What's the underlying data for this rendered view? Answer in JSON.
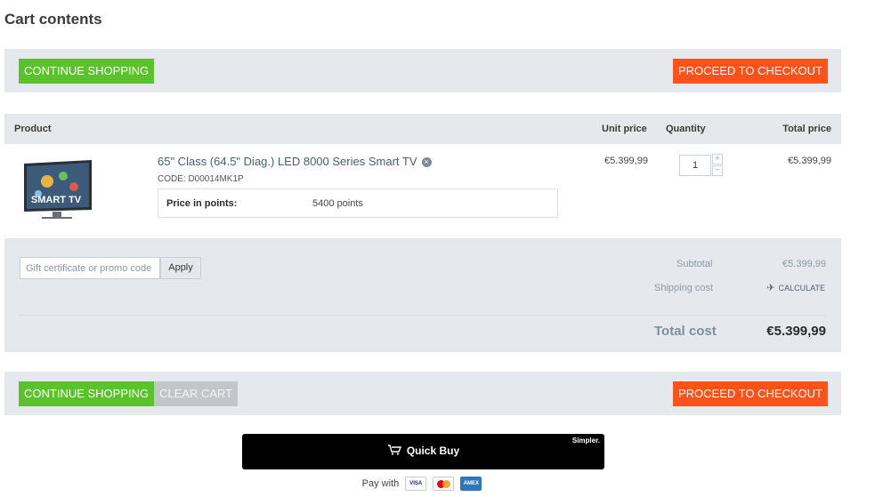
{
  "page": {
    "title": "Cart contents"
  },
  "buttons": {
    "continue_shopping": "CONTINUE SHOPPING",
    "proceed_to_checkout": "PROCEED TO CHECKOUT",
    "clear_cart": "CLEAR CART"
  },
  "table": {
    "headers": {
      "product": "Product",
      "unit_price": "Unit price",
      "quantity": "Quantity",
      "total_price": "Total price"
    },
    "items": [
      {
        "name": "65\" Class (64.5\" Diag.) LED 8000 Series Smart TV",
        "code": "CODE: D00014MK1P",
        "points_label": "Price in points:",
        "points_value": "5400 points",
        "unit_price": "€5.399,99",
        "quantity": "1",
        "total_price": "€5.399,99",
        "thumb_text": "SMART TV"
      }
    ]
  },
  "summary": {
    "promo_placeholder": "Gift certificate or promo code",
    "apply_label": "Apply",
    "subtotal_label": "Subtotal",
    "subtotal_value": "€5.399,99",
    "shipping_label": "Shipping cost",
    "shipping_action": "CALCULATE",
    "total_label": "Total cost",
    "total_value": "€5.399,99"
  },
  "quick_buy": {
    "label": "Quick Buy",
    "brand": "Simpler."
  },
  "payment": {
    "label": "Pay with",
    "cards": [
      "VISA",
      "mastercard",
      "AMEX"
    ]
  },
  "colors": {
    "green": "#5ac22a",
    "orange": "#ff5219",
    "bar_gray": "#e5e8ec"
  },
  "icons": {
    "remove": "close-circle-icon",
    "shipping": "plane-icon",
    "quick_buy": "cart-lightning-icon"
  }
}
